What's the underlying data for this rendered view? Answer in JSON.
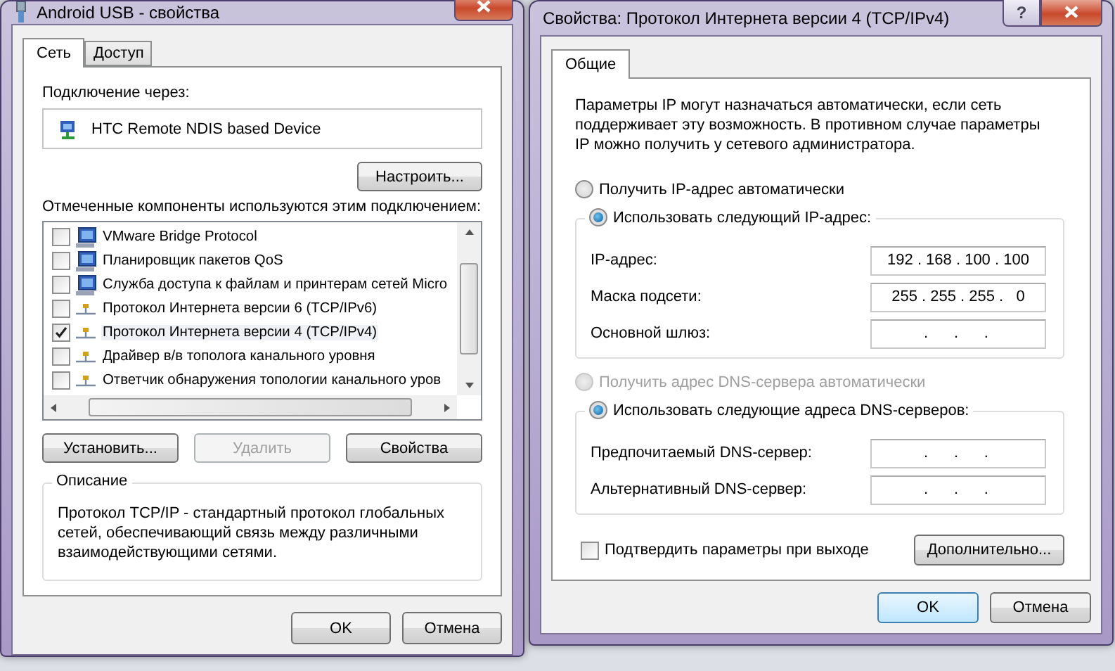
{
  "left_window": {
    "title": "Android USB - свойства",
    "tabs": [
      {
        "label": "Сеть",
        "selected": true
      },
      {
        "label": "Доступ",
        "selected": false
      }
    ],
    "connect_label": "Подключение через:",
    "device": "HTC Remote NDIS based Device",
    "configure_button": "Настроить...",
    "components_label": "Отмеченные компоненты используются этим подключением:",
    "components": [
      {
        "label": "VMware Bridge Protocol",
        "kind": "service",
        "checked": false,
        "selected": false
      },
      {
        "label": "Планировщик пакетов QoS",
        "kind": "service",
        "checked": false,
        "selected": false
      },
      {
        "label": "Служба доступа к файлам и принтерам сетей Micro",
        "kind": "service",
        "checked": false,
        "selected": false
      },
      {
        "label": "Протокол Интернета версии 6 (TCP/IPv6)",
        "kind": "protocol",
        "checked": false,
        "selected": false
      },
      {
        "label": "Протокол Интернета версии 4 (TCP/IPv4)",
        "kind": "protocol",
        "checked": true,
        "selected": true
      },
      {
        "label": "Драйвер в/в тополога канального уровня",
        "kind": "protocol",
        "checked": false,
        "selected": false
      },
      {
        "label": "Ответчик обнаружения топологии канального уров",
        "kind": "protocol",
        "checked": false,
        "selected": false
      }
    ],
    "action_buttons": [
      {
        "label": "Установить...",
        "disabled": false
      },
      {
        "label": "Удалить",
        "disabled": true
      },
      {
        "label": "Свойства",
        "disabled": false
      }
    ],
    "description_title": "Описание",
    "description": "Протокол TCP/IP - стандартный протокол глобальных сетей, обеспечивающий связь между различными взаимодействующими сетями.",
    "buttons": [
      {
        "label": "OK",
        "default": false
      },
      {
        "label": "Отмена",
        "default": false
      }
    ]
  },
  "right_window": {
    "title": "Свойства: Протокол Интернета версии 4 (TCP/IPv4)",
    "help_button": "?",
    "tabs": [
      {
        "label": "Общие",
        "selected": true
      }
    ],
    "intro": "Параметры IP могут назначаться автоматически, если сеть поддерживает эту возможность. В противном случае параметры IP можно получить у сетевого администратора.",
    "ip_auto": {
      "label": "Получить IP-адрес автоматически",
      "selected": false,
      "disabled": false
    },
    "ip_manual": {
      "label": "Использовать следующий IP-адрес:",
      "selected": true,
      "disabled": false
    },
    "ip_fields": [
      {
        "label": "IP-адрес:",
        "value": "192 . 168 . 100 . 100"
      },
      {
        "label": "Маска подсети:",
        "value": "255 . 255 . 255 .   0"
      },
      {
        "label": "Основной шлюз:",
        "value": "  .      .      .   "
      }
    ],
    "dns_auto": {
      "label": "Получить адрес DNS-сервера автоматически",
      "selected": false,
      "disabled": true
    },
    "dns_manual": {
      "label": "Использовать следующие адреса DNS-серверов:",
      "selected": true,
      "disabled": false
    },
    "dns_fields": [
      {
        "label": "Предпочитаемый DNS-сервер:",
        "value": "  .      .      .   "
      },
      {
        "label": "Альтернативный DNS-сервер:",
        "value": "  .      .      .   "
      }
    ],
    "confirm": {
      "label": "Подтвердить параметры при выходе",
      "checked": false
    },
    "advanced_button": "Дополнительно...",
    "buttons": [
      {
        "label": "OK",
        "default": true
      },
      {
        "label": "Отмена",
        "default": false
      }
    ]
  }
}
